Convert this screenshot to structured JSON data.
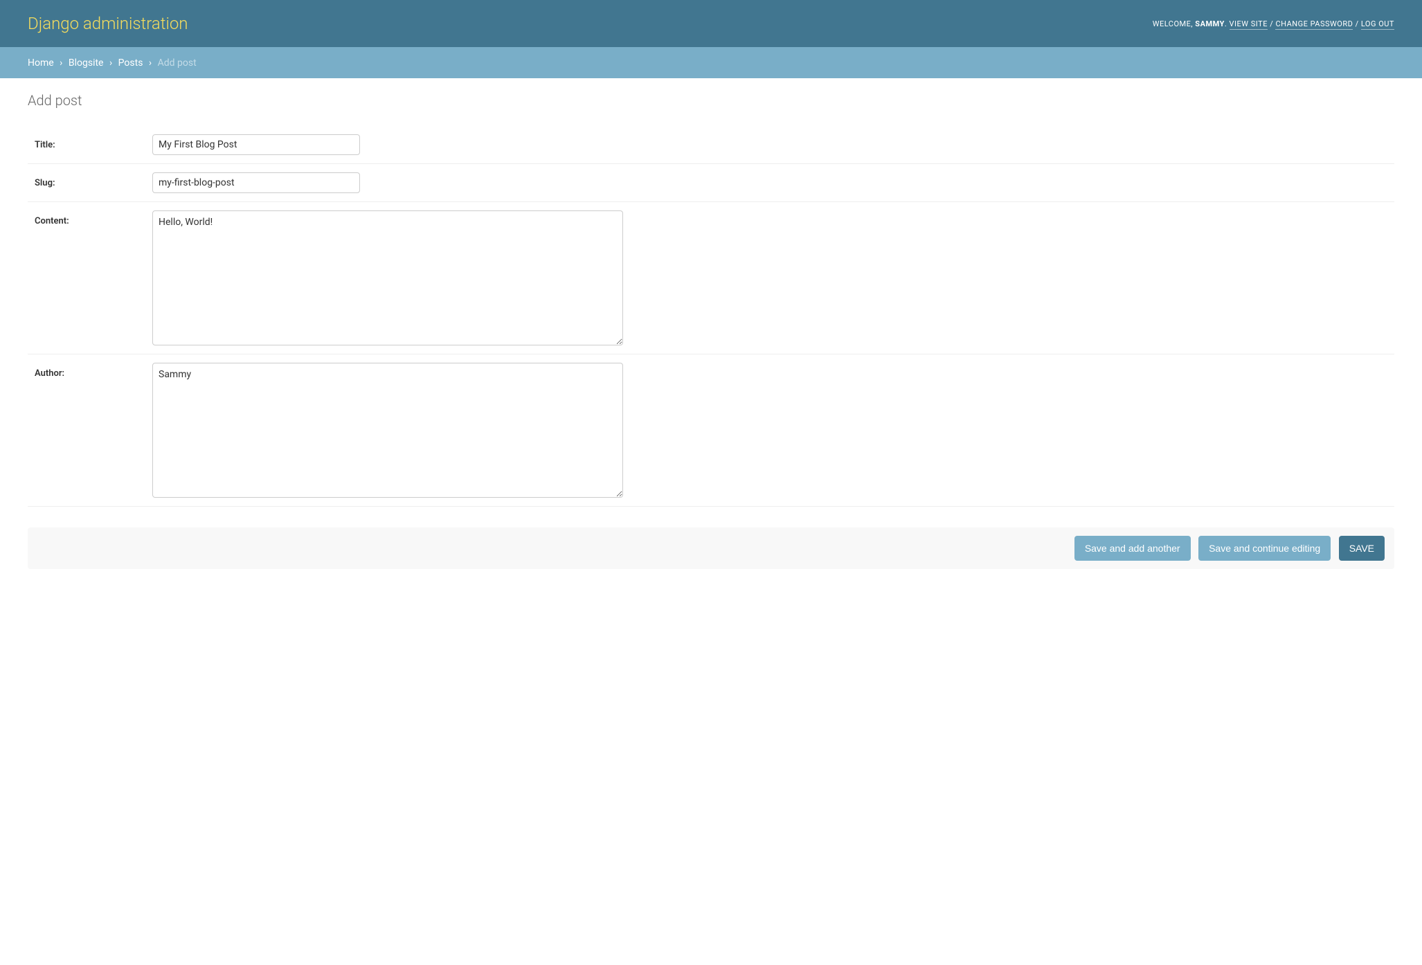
{
  "header": {
    "branding": "Django administration",
    "welcome": "WELCOME,",
    "username": "SAMMY",
    "view_site": "VIEW SITE",
    "change_password": "CHANGE PASSWORD",
    "log_out": "LOG OUT"
  },
  "breadcrumbs": {
    "home": "Home",
    "app": "Blogsite",
    "model": "Posts",
    "current": "Add post"
  },
  "page": {
    "title": "Add post"
  },
  "form": {
    "title_label": "Title:",
    "title_value": "My First Blog Post",
    "slug_label": "Slug:",
    "slug_value": "my-first-blog-post",
    "content_label": "Content:",
    "content_value": "Hello, World!",
    "author_label": "Author:",
    "author_value": "Sammy"
  },
  "buttons": {
    "save_add_another": "Save and add another",
    "save_continue": "Save and continue editing",
    "save": "SAVE"
  }
}
